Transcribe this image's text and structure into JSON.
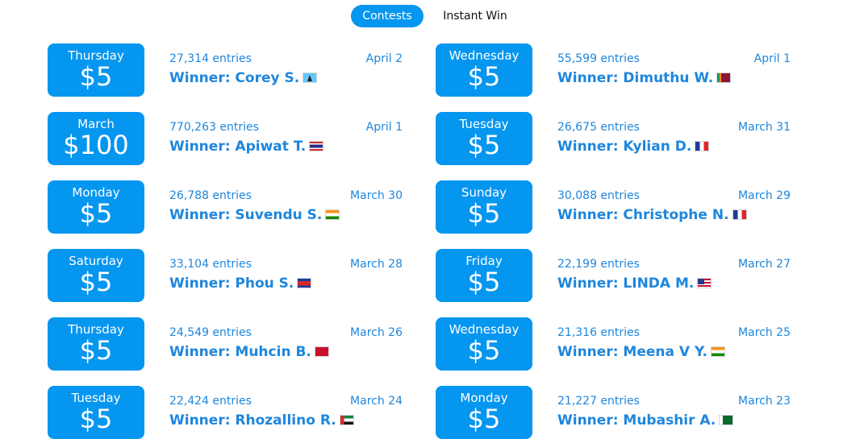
{
  "tabs": [
    {
      "label": "Contests",
      "active": true
    },
    {
      "label": "Instant Win",
      "active": false
    }
  ],
  "colors": {
    "accent": "#0596f0",
    "text_blue": "#1e86dc",
    "background": "#ffffff"
  },
  "contests": [
    {
      "left": {
        "day": "Thursday",
        "amount": "$5",
        "entries": "27,314 entries",
        "date": "April 2",
        "winner": "Winner: Corey S.",
        "flag": "lc"
      },
      "right": {
        "day": "Wednesday",
        "amount": "$5",
        "entries": "55,599 entries",
        "date": "April 1",
        "winner": "Winner: Dimuthu W.",
        "flag": "lk"
      }
    },
    {
      "left": {
        "day": "March",
        "amount": "$100",
        "entries": "770,263 entries",
        "date": "April 1",
        "winner": "Winner: Apiwat T.",
        "flag": "th"
      },
      "right": {
        "day": "Tuesday",
        "amount": "$5",
        "entries": "26,675 entries",
        "date": "March 31",
        "winner": "Winner: Kylian D.",
        "flag": "fr"
      }
    },
    {
      "left": {
        "day": "Monday",
        "amount": "$5",
        "entries": "26,788 entries",
        "date": "March 30",
        "winner": "Winner: Suvendu S.",
        "flag": "in"
      },
      "right": {
        "day": "Sunday",
        "amount": "$5",
        "entries": "30,088 entries",
        "date": "March 29",
        "winner": "Winner: Christophe N.",
        "flag": "fr"
      }
    },
    {
      "left": {
        "day": "Saturday",
        "amount": "$5",
        "entries": "33,104 entries",
        "date": "March 28",
        "winner": "Winner: Phou S.",
        "flag": "kh"
      },
      "right": {
        "day": "Friday",
        "amount": "$5",
        "entries": "22,199 entries",
        "date": "March 27",
        "winner": "Winner: LINDA M.",
        "flag": "us"
      }
    },
    {
      "left": {
        "day": "Thursday",
        "amount": "$5",
        "entries": "24,549 entries",
        "date": "March 26",
        "winner": "Winner: Muhcin B.",
        "flag": "ma"
      },
      "right": {
        "day": "Wednesday",
        "amount": "$5",
        "entries": "21,316 entries",
        "date": "March 25",
        "winner": "Winner: Meena V Y.",
        "flag": "in"
      }
    },
    {
      "left": {
        "day": "Tuesday",
        "amount": "$5",
        "entries": "22,424 entries",
        "date": "March 24",
        "winner": "Winner: Rhozallino R.",
        "flag": "ae"
      },
      "right": {
        "day": "Monday",
        "amount": "$5",
        "entries": "21,227 entries",
        "date": "March 23",
        "winner": "Winner: Mubashir A.",
        "flag": "pk"
      }
    }
  ]
}
